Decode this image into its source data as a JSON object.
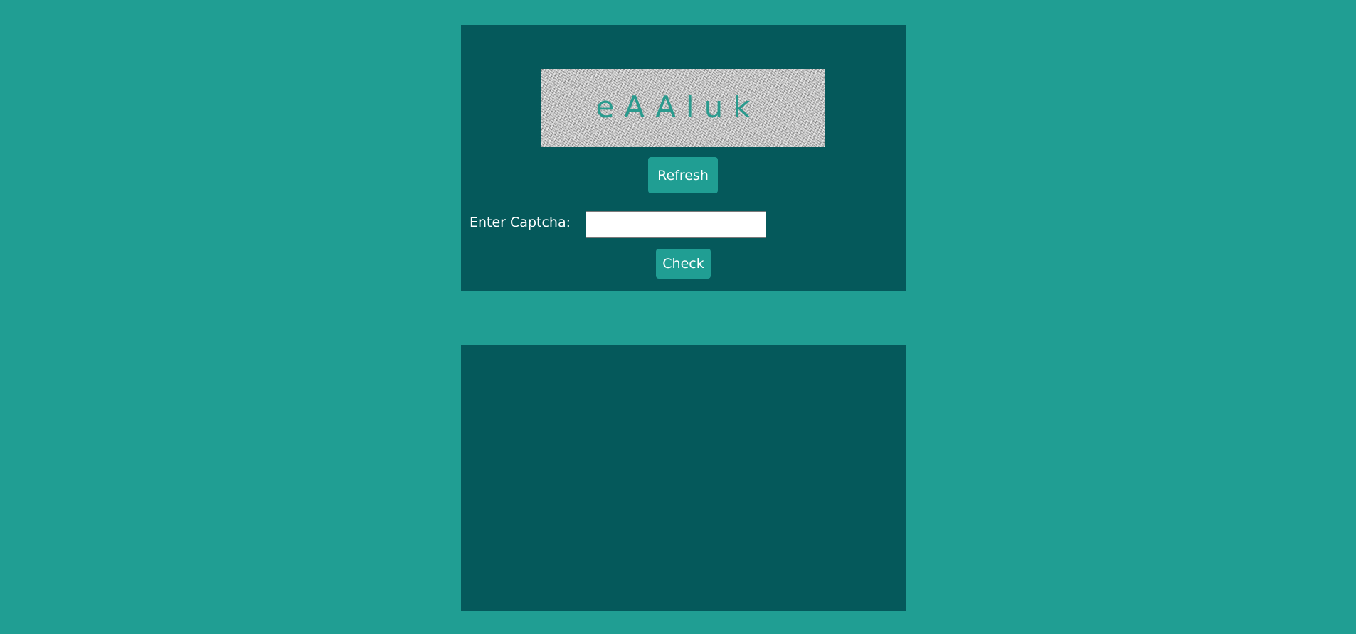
{
  "captcha": {
    "code": "eAAluk",
    "refresh_label": "Refresh",
    "input_label": "Enter Captcha:",
    "input_value": "",
    "input_placeholder": "",
    "check_label": "Check"
  },
  "result": {
    "message": ""
  },
  "colors": {
    "page_background": "#209e93",
    "panel_background": "#05595b",
    "button_background": "#209e93",
    "captcha_text": "#2a9b8e"
  }
}
